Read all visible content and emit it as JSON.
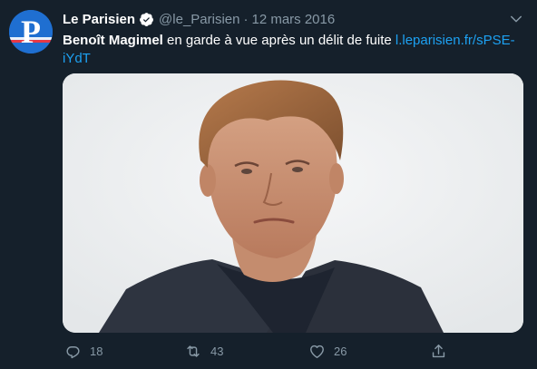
{
  "account": {
    "name": "Le Parisien",
    "handle": "@le_Parisien",
    "separator": "·",
    "date": "12 mars 2016",
    "avatar_letter": "P"
  },
  "tweet": {
    "bold_text": "Benoît Magimel",
    "text": " en garde à vue après un délit de fuite ",
    "link": "l.leparisien.fr/sPSE-iYdT"
  },
  "actions": {
    "replies": "18",
    "retweets": "43",
    "likes": "26"
  },
  "icons": [
    "verified-badge-icon",
    "more-chevron-icon",
    "reply-icon",
    "retweet-icon",
    "like-icon",
    "share-icon"
  ],
  "colors": {
    "background": "#15202b",
    "link": "#1da1f2",
    "muted": "#8899a6",
    "avatar": "#1f6fd1"
  }
}
